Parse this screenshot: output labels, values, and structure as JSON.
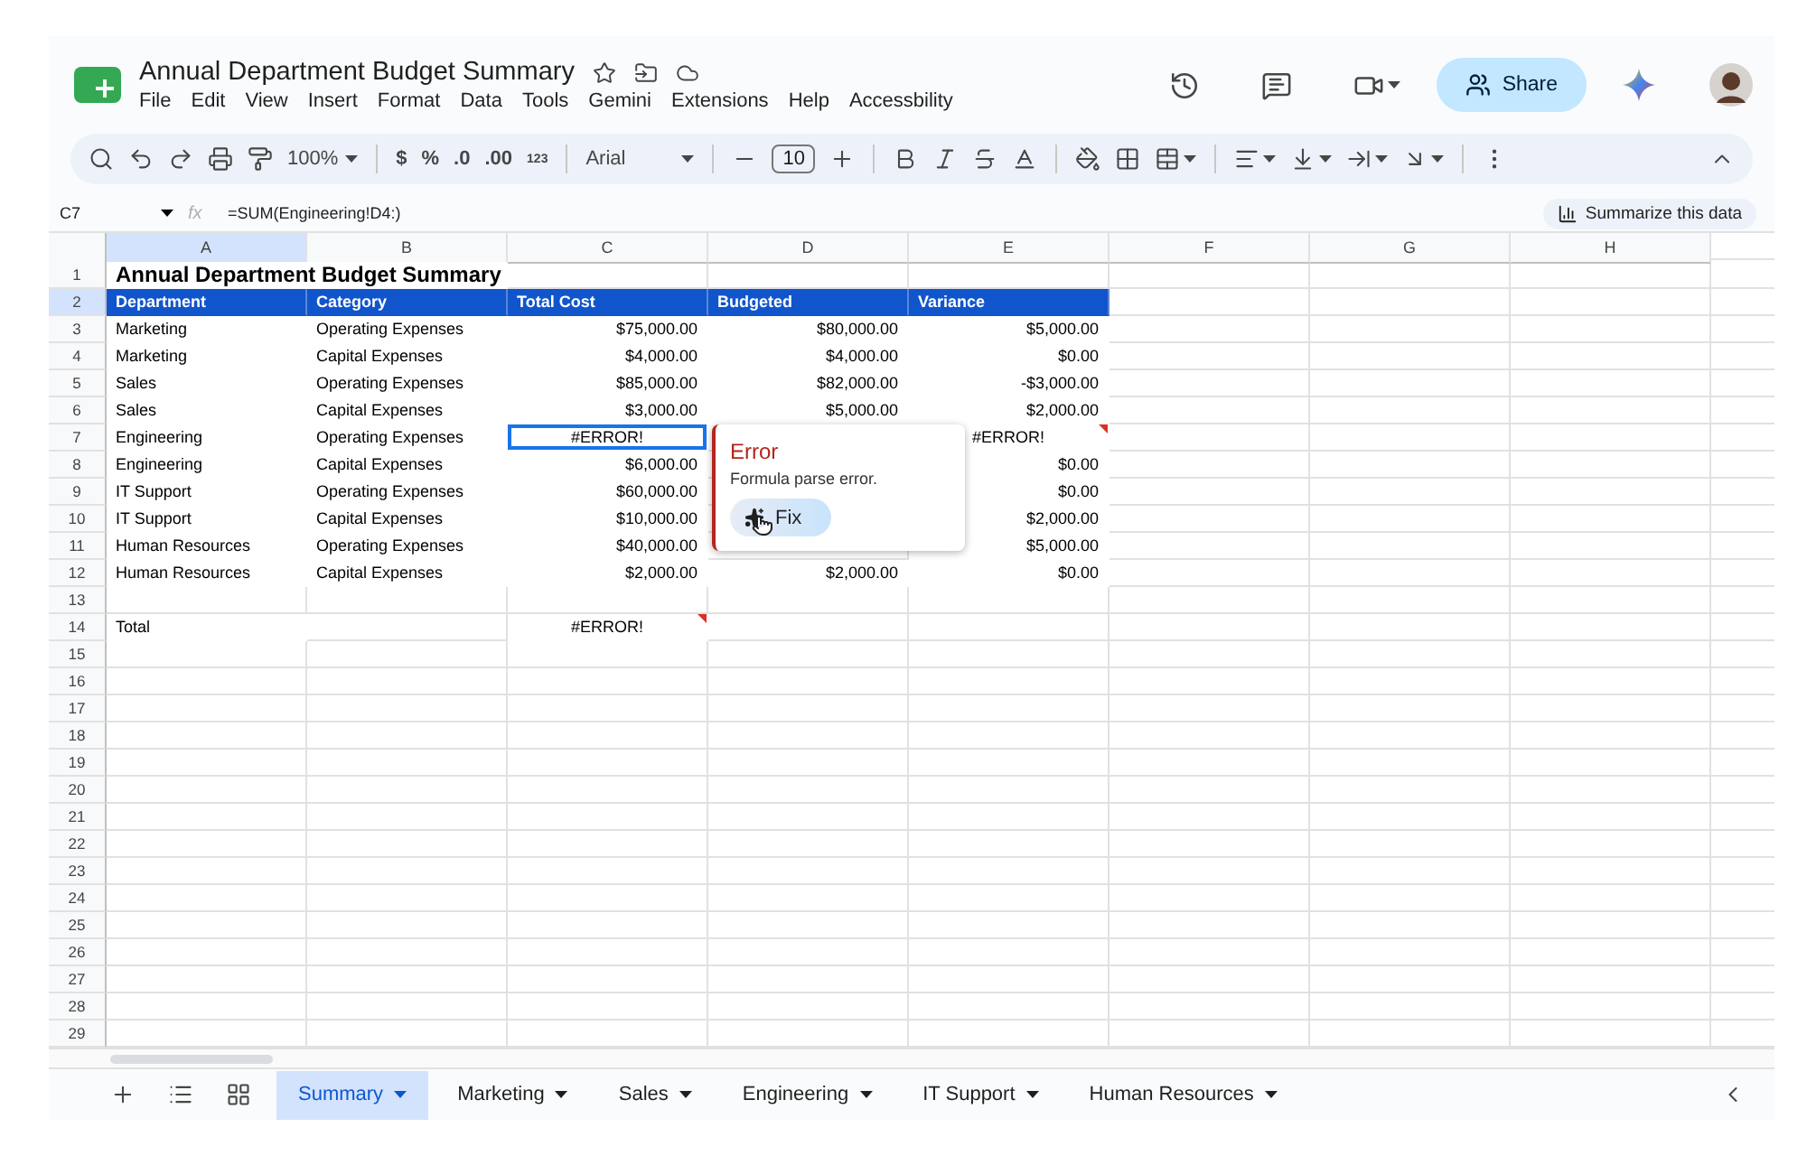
{
  "document": {
    "title": "Annual Department Budget Summary"
  },
  "menu": [
    "File",
    "Edit",
    "View",
    "Insert",
    "Format",
    "Data",
    "Tools",
    "Gemini",
    "Extensions",
    "Help",
    "Accessbility"
  ],
  "share_button": "Share",
  "toolbar": {
    "zoom": "100%",
    "currency": "$",
    "percent": "%",
    "decrease_decimals": ".0",
    "increase_decimals": ".00",
    "more_formats": "123",
    "font": "Arial",
    "font_size": "10"
  },
  "formula_bar": {
    "name_box": "C7",
    "fx_label": "fx",
    "formula": "=SUM(Engineering!D4:)",
    "summarize_button": "Summarize this data"
  },
  "columns": [
    {
      "label": "A",
      "selected": true
    },
    {
      "label": "B",
      "selected": false
    },
    {
      "label": "C",
      "selected": false
    },
    {
      "label": "D",
      "selected": false
    },
    {
      "label": "E",
      "selected": false
    },
    {
      "label": "F",
      "selected": false
    },
    {
      "label": "G",
      "selected": false
    },
    {
      "label": "H",
      "selected": false
    }
  ],
  "rows": [
    {
      "num": "1",
      "kind": "title",
      "selected": false,
      "cells": [
        "Annual Department Budget Summary"
      ]
    },
    {
      "num": "2",
      "kind": "header",
      "selected": true,
      "cells": [
        "Department",
        "Category",
        "Total Cost",
        "Budgeted",
        "Variance"
      ]
    },
    {
      "num": "3",
      "kind": "data",
      "selected": false,
      "cells": [
        "Marketing",
        "Operating Expenses",
        "$75,000.00",
        "$80,000.00",
        "$5,000.00"
      ]
    },
    {
      "num": "4",
      "kind": "data",
      "selected": false,
      "cells": [
        "Marketing",
        "Capital Expenses",
        "$4,000.00",
        "$4,000.00",
        "$0.00"
      ]
    },
    {
      "num": "5",
      "kind": "data",
      "selected": false,
      "cells": [
        "Sales",
        "Operating Expenses",
        "$85,000.00",
        "$82,000.00",
        "-$3,000.00"
      ]
    },
    {
      "num": "6",
      "kind": "data",
      "selected": false,
      "cells": [
        "Sales",
        "Capital Expenses",
        "$3,000.00",
        "$5,000.00",
        "$2,000.00"
      ]
    },
    {
      "num": "7",
      "kind": "data",
      "selected": false,
      "cells": [
        "Engineering",
        "Operating Expenses",
        {
          "text": "#ERROR!",
          "selected": true,
          "error": false
        },
        null,
        {
          "text": "#ERROR!",
          "selected": false,
          "error": true
        }
      ]
    },
    {
      "num": "8",
      "kind": "data",
      "selected": false,
      "cells": [
        "Engineering",
        "Capital Expenses",
        "$6,000.00",
        null,
        "$0.00"
      ]
    },
    {
      "num": "9",
      "kind": "data",
      "selected": false,
      "cells": [
        "IT Support",
        "Operating Expenses",
        "$60,000.00",
        null,
        "$0.00"
      ]
    },
    {
      "num": "10",
      "kind": "data",
      "selected": false,
      "cells": [
        "IT Support",
        "Capital Expenses",
        "$10,000.00",
        null,
        "$2,000.00"
      ]
    },
    {
      "num": "11",
      "kind": "data",
      "selected": false,
      "cells": [
        "Human Resources",
        "Operating Expenses",
        "$40,000.00",
        null,
        "$5,000.00"
      ]
    },
    {
      "num": "12",
      "kind": "data",
      "selected": false,
      "cells": [
        "Human Resources",
        "Capital Expenses",
        "$2,000.00",
        "$2,000.00",
        "$0.00"
      ]
    },
    {
      "num": "13",
      "kind": "data",
      "selected": false,
      "cells": []
    },
    {
      "num": "14",
      "kind": "data",
      "selected": false,
      "cells": [
        "Total",
        null,
        {
          "text": "#ERROR!",
          "selected": false,
          "error": true
        }
      ]
    },
    {
      "num": "15",
      "kind": "data",
      "selected": false,
      "cells": []
    },
    {
      "num": "16",
      "kind": "data",
      "selected": false,
      "cells": []
    },
    {
      "num": "17",
      "kind": "data",
      "selected": false,
      "cells": []
    },
    {
      "num": "18",
      "kind": "data",
      "selected": false,
      "cells": []
    },
    {
      "num": "19",
      "kind": "data",
      "selected": false,
      "cells": []
    },
    {
      "num": "20",
      "kind": "data",
      "selected": false,
      "cells": []
    },
    {
      "num": "21",
      "kind": "data",
      "selected": false,
      "cells": []
    },
    {
      "num": "22",
      "kind": "data",
      "selected": false,
      "cells": []
    },
    {
      "num": "23",
      "kind": "data",
      "selected": false,
      "cells": []
    },
    {
      "num": "24",
      "kind": "data",
      "selected": false,
      "cells": []
    },
    {
      "num": "25",
      "kind": "data",
      "selected": false,
      "cells": []
    },
    {
      "num": "26",
      "kind": "data",
      "selected": false,
      "cells": []
    },
    {
      "num": "27",
      "kind": "data",
      "selected": false,
      "cells": []
    },
    {
      "num": "28",
      "kind": "data",
      "selected": false,
      "cells": []
    },
    {
      "num": "29",
      "kind": "data",
      "selected": false,
      "cells": []
    }
  ],
  "error_popup": {
    "title": "Error",
    "message": "Formula parse error.",
    "fix_button": "Fix"
  },
  "sheet_tabs": [
    {
      "label": "Summary",
      "selected": true
    },
    {
      "label": "Marketing",
      "selected": false
    },
    {
      "label": "Sales",
      "selected": false
    },
    {
      "label": "Engineering",
      "selected": false
    },
    {
      "label": "IT Support",
      "selected": false
    },
    {
      "label": "Human Resources",
      "selected": false
    }
  ]
}
